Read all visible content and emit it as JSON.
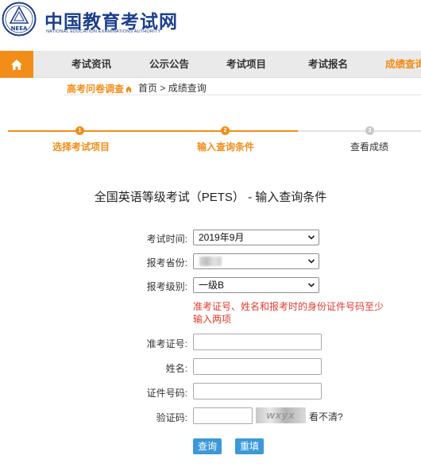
{
  "site": {
    "name_cn": "中国教育考试网",
    "name_en": "NATIONAL EDUCATION EXAMINATIONS AUTHORITY",
    "logo_text": "NEEA"
  },
  "nav": {
    "items": [
      "考试资讯",
      "公示公告",
      "考试项目",
      "考试报名",
      "成绩查询"
    ],
    "active": "成绩查询"
  },
  "breadcrumb": {
    "survey": "高考问卷调查",
    "home": "首页",
    "separator": ">",
    "current": "成绩查询"
  },
  "steps": [
    {
      "num": "1",
      "label": "选择考试项目",
      "state": "done"
    },
    {
      "num": "2",
      "label": "输入查询条件",
      "state": "active"
    },
    {
      "num": "3",
      "label": "查看成绩",
      "state": "pending"
    }
  ],
  "form": {
    "title": "全国英语等级考试（PETS） - 输入查询条件",
    "exam_time_label": "考试时间:",
    "exam_time_value": "2019年9月",
    "province_label": "报考省份:",
    "level_label": "报考级别:",
    "level_value": "一级B",
    "warning": "准考证号、姓名和报考时的身份证件号码至少输入两项",
    "ticket_label": "准考证号:",
    "name_label": "姓名:",
    "id_label": "证件号码:",
    "captcha_label": "验证码:",
    "captcha_text": "wxyx",
    "captcha_refresh": "看不清?"
  },
  "buttons": {
    "query": "查询",
    "reset": "重填"
  },
  "colors": {
    "brand_blue": "#1d3f8c",
    "accent_orange": "#f28d17",
    "warning_red": "#e23a2e",
    "button_blue": "#3b99d8"
  }
}
